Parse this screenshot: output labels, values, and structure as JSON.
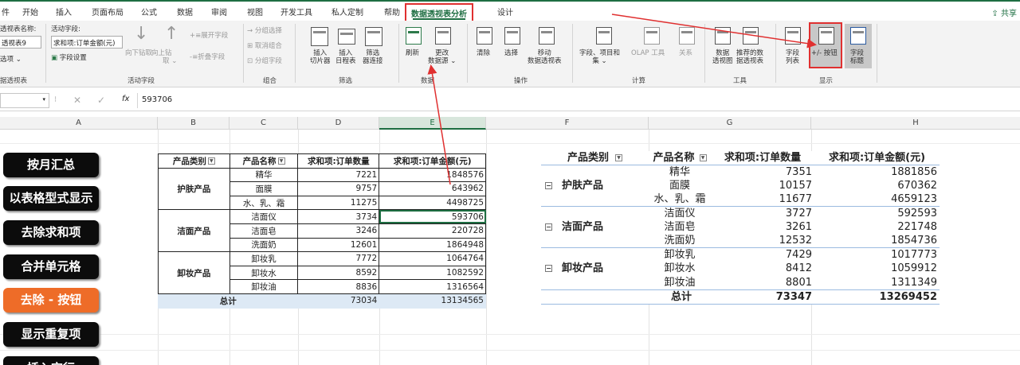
{
  "ribbon_tabs": [
    "件",
    "开始",
    "插入",
    "页面布局",
    "公式",
    "数据",
    "审阅",
    "视图",
    "开发工具",
    "私人定制",
    "帮助",
    "数据透视表分析",
    "设计"
  ],
  "active_tab": "数据透视表分析",
  "share_label": "共享",
  "pivot_group": {
    "name_label": "透视表名称:",
    "name_value": "透视表9",
    "options_label": "选项 ⌄",
    "group_label": "据透视表"
  },
  "active_field": {
    "label": "活动字段:",
    "value": "求和项:订单金额(元)",
    "settings": "字段设置",
    "drill_down": "向下钻取",
    "drill_up": "向上钻",
    "drill_up2": "取 ⌄",
    "expand": "展开字段",
    "collapse": "折叠字段",
    "group_label": "活动字段"
  },
  "group_group": {
    "select": "分组选择",
    "ungroup": "取消组合",
    "field": "分组字段",
    "group_label": "组合"
  },
  "filter_group": {
    "slicer1": "插入",
    "slicer2": "切片器",
    "timeline1": "插入",
    "timeline2": "日程表",
    "conn1": "筛选",
    "conn2": "器连接",
    "group_label": "筛选"
  },
  "data_group": {
    "refresh": "刷新",
    "change1": "更改",
    "change2": "数据源 ⌄",
    "group_label": "数据"
  },
  "ops_group": {
    "clear": "清除",
    "select": "选择",
    "move1": "移动",
    "move2": "数据透视表",
    "group_label": "操作"
  },
  "calc_group": {
    "fields1": "字段、项目和",
    "fields2": "集 ⌄",
    "olap": "OLAP 工具",
    "rel": "关系",
    "group_label": "计算"
  },
  "tools_group": {
    "pc1": "数据",
    "pc2": "透视图",
    "rec1": "推荐的数",
    "rec2": "据透视表",
    "group_label": "工具"
  },
  "show_group": {
    "list1": "字段",
    "list2": "列表",
    "buttons": "+/- 按钮",
    "headers1": "字段",
    "headers2": "标题",
    "group_label": "显示"
  },
  "formula_bar": {
    "name_box": "",
    "fx": "fx",
    "value": "593706"
  },
  "columns": [
    "A",
    "B",
    "C",
    "D",
    "E",
    "F",
    "G",
    "H"
  ],
  "side_buttons": [
    "按月汇总",
    "以表格型式显示",
    "去除求和项",
    "合并单元格",
    "去除 - 按钮",
    "显示重复项",
    "插入空行"
  ],
  "highlight_color": "#ee6c28",
  "table1": {
    "headers": [
      "产品类别",
      "产品名称",
      "求和项:订单数量",
      "求和项:订单金额(元)"
    ],
    "groups": [
      {
        "category": "护肤产品",
        "rows": [
          [
            "精华",
            "7221",
            "1848576"
          ],
          [
            "面膜",
            "9757",
            "643962"
          ],
          [
            "水、乳、霜",
            "11275",
            "4498725"
          ]
        ]
      },
      {
        "category": "洁面产品",
        "rows": [
          [
            "洁面仪",
            "3734",
            "593706"
          ],
          [
            "洁面皂",
            "3246",
            "220728"
          ],
          [
            "洗面奶",
            "12601",
            "1864948"
          ]
        ]
      },
      {
        "category": "卸妆产品",
        "rows": [
          [
            "卸妆乳",
            "7772",
            "1064764"
          ],
          [
            "卸妆水",
            "8592",
            "1082592"
          ],
          [
            "卸妆油",
            "8836",
            "1316564"
          ]
        ]
      }
    ],
    "total": {
      "label": "总计",
      "qty": "73034",
      "amount": "13134565"
    }
  },
  "table2": {
    "headers": [
      "产品类别",
      "产品名称",
      "求和项:订单数量",
      "求和项:订单金额(元)"
    ],
    "groups": [
      {
        "category": "护肤产品",
        "rows": [
          [
            "精华",
            "7351",
            "1881856"
          ],
          [
            "面膜",
            "10157",
            "670362"
          ],
          [
            "水、乳、霜",
            "11677",
            "4659123"
          ]
        ]
      },
      {
        "category": "洁面产品",
        "rows": [
          [
            "洁面仪",
            "3727",
            "592593"
          ],
          [
            "洁面皂",
            "3261",
            "221748"
          ],
          [
            "洗面奶",
            "12532",
            "1854736"
          ]
        ]
      },
      {
        "category": "卸妆产品",
        "rows": [
          [
            "卸妆乳",
            "7429",
            "1017773"
          ],
          [
            "卸妆水",
            "8412",
            "1059912"
          ],
          [
            "卸妆油",
            "8801",
            "1311349"
          ]
        ]
      }
    ],
    "total": {
      "label": "总计",
      "qty": "73347",
      "amount": "13269452"
    }
  }
}
